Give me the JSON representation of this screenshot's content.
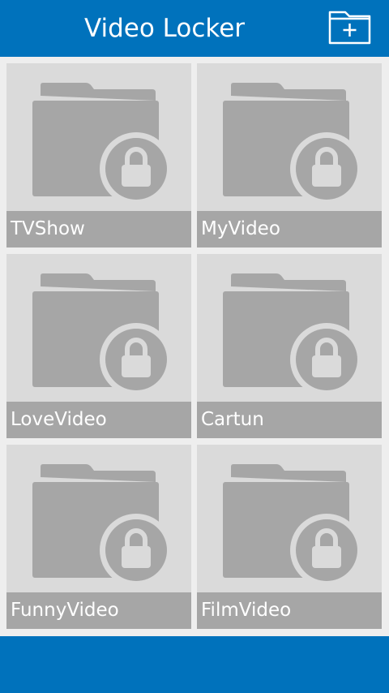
{
  "app_bar": {
    "title": "Video Locker",
    "add_icon": "folder-plus-icon"
  },
  "folders": [
    {
      "label": "TVShow",
      "icon": "locked-folder-icon"
    },
    {
      "label": "MyVideo",
      "icon": "locked-folder-icon"
    },
    {
      "label": "LoveVideo",
      "icon": "locked-folder-icon"
    },
    {
      "label": "Cartun",
      "icon": "locked-folder-icon"
    },
    {
      "label": "FunnyVideo",
      "icon": "locked-folder-icon"
    },
    {
      "label": "FilmVideo",
      "icon": "locked-folder-icon"
    }
  ],
  "colors": {
    "primary": "#0072bc",
    "tile_background": "#dadada",
    "label_bar": "#a6a6a6",
    "icon": "#a6a6a6",
    "text": "#ffffff"
  }
}
